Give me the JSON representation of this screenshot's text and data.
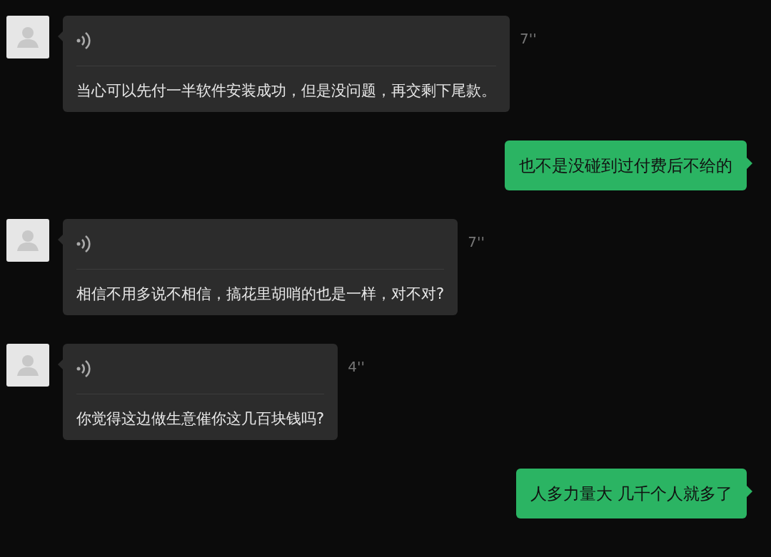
{
  "messages": [
    {
      "sent": false,
      "duration": "7''",
      "text": "当心可以先付一半软件安装成功，但是没问题，再交剩下尾款。"
    },
    {
      "sent": true,
      "text": "也不是没碰到过付费后不给的"
    },
    {
      "sent": false,
      "duration": "7''",
      "text": "相信不用多说不相信，搞花里胡哨的也是一样，对不对?"
    },
    {
      "sent": false,
      "duration": "4''",
      "text": "你觉得这边做生意催你这几百块钱吗?"
    },
    {
      "sent": true,
      "text": "人多力量大 几千个人就多了"
    }
  ]
}
